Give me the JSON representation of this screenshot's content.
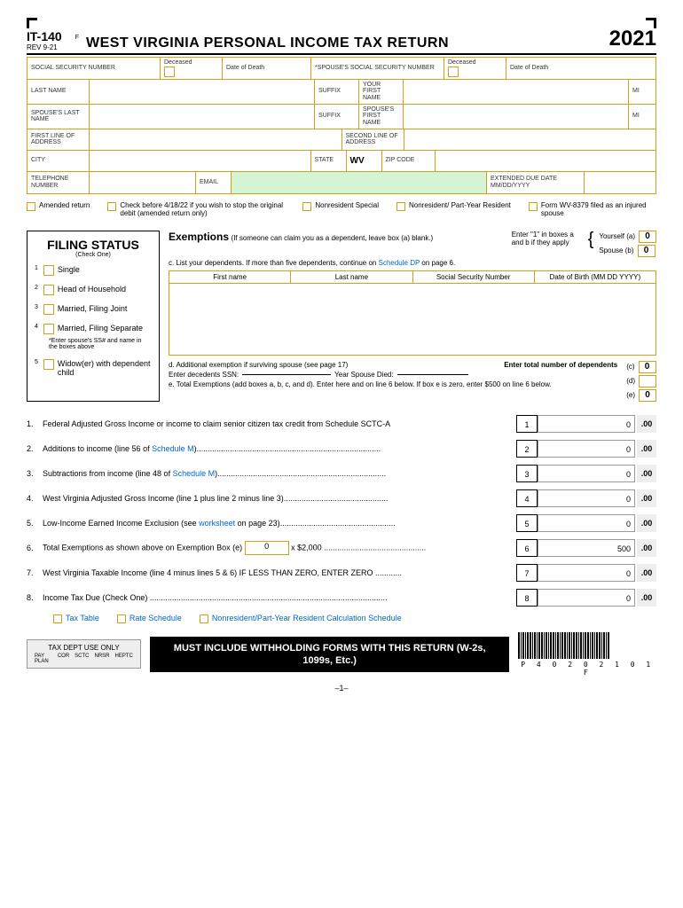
{
  "header": {
    "form_num": "IT-140",
    "rev": "REV 9-21",
    "marker": "F",
    "title": "WEST VIRGINIA PERSONAL INCOME TAX RETURN",
    "year": "2021"
  },
  "info": {
    "ssn": "SOCIAL SECURITY NUMBER",
    "deceased": "Deceased",
    "dod": "Date of Death",
    "spouse_ssn": "*SPOUSE'S SOCIAL SECURITY NUMBER",
    "last_name": "LAST NAME",
    "suffix": "SUFFIX",
    "first_name": "YOUR FIRST NAME",
    "mi": "MI",
    "spouse_last": "SPOUSE'S LAST NAME",
    "spouse_first": "SPOUSE'S FIRST NAME",
    "addr1": "FIRST LINE OF ADDRESS",
    "addr2": "SECOND LINE OF ADDRESS",
    "city": "CITY",
    "state": "STATE",
    "state_val": "WV",
    "zip": "ZIP CODE",
    "phone": "TELEPHONE NUMBER",
    "email": "EMAIL",
    "ext_due": "EXTENDED DUE DATE MM/DD/YYYY"
  },
  "checkboxes": {
    "amended": "Amended return",
    "check_before": "Check before 4/18/22 if you wish to stop the original debit (amended return only)",
    "nonres_special": "Nonresident Special",
    "nonres_part": "Nonresident/ Part-Year Resident",
    "wv8379": "Form WV-8379 filed as an injured spouse"
  },
  "filing": {
    "title": "FILING STATUS",
    "sub": "(Check One)",
    "single": "Single",
    "hoh": "Head of Household",
    "mfj": "Married, Filing Joint",
    "mfs": "Married, Filing Separate",
    "mfs_note": "*Enter spouse's SS# and name in the boxes above",
    "widow": "Widow(er) with dependent child"
  },
  "exemptions": {
    "title": "Exemptions",
    "note": "(If someone can claim you as a dependent, leave box (a) blank.)",
    "enter1": "Enter \"1\" in boxes a and b if they apply",
    "yourself": "Yourself (a)",
    "spouse": "Spouse (b)",
    "a_val": "0",
    "b_val": "0",
    "list_note": "c. List your dependents. If more than five dependents, continue on",
    "sched_dp": "Schedule DP",
    "on_page": "on page 6.",
    "col_fn": "First name",
    "col_ln": "Last name",
    "col_ssn": "Social Security Number",
    "col_dob": "Date of Birth (MM DD YYYY)",
    "d_text": "d. Additional exemption if surviving spouse (see page 17)",
    "d_ssn": "Enter decedents SSN:",
    "d_year": "Year Spouse Died:",
    "enter_total": "Enter total number of dependents",
    "e_text": "e. Total Exemptions (add boxes a, b, c, and d). Enter here and on line 6 below. If box e is zero, enter $500 on line 6 below.",
    "c_val": "0",
    "d_val": "",
    "e_val": "0"
  },
  "lines": [
    {
      "num": "1.",
      "text": "Federal Adjusted Gross Income or income to claim senior citizen tax credit from Schedule SCTC-A",
      "box": "1",
      "amount": "0"
    },
    {
      "num": "2.",
      "text": "Additions to income (line 56 of",
      "link": "Schedule M",
      "after": ")",
      "box": "2",
      "amount": "0"
    },
    {
      "num": "3.",
      "text": "Subtractions from income (line 48 of",
      "link": "Schedule M",
      "after": ")",
      "box": "3",
      "amount": "0"
    },
    {
      "num": "4.",
      "text": "West Virginia Adjusted Gross Income (line 1 plus line 2 minus line 3)",
      "box": "4",
      "amount": "0"
    },
    {
      "num": "5.",
      "text": "Low-Income Earned Income Exclusion (see",
      "link": "worksheet",
      "after": " on page 23)",
      "box": "5",
      "amount": "0"
    },
    {
      "num": "6.",
      "text": "Total Exemptions as shown above on Exemption Box (e)",
      "inline_val": "0",
      "after": " x $2,000 ",
      "box": "6",
      "amount": "500"
    },
    {
      "num": "7.",
      "text": "West Virginia Taxable Income (line 4 minus lines 5 & 6) IF LESS THAN ZERO, ENTER ZERO ",
      "box": "7",
      "amount": "0"
    },
    {
      "num": "8.",
      "text": "Income Tax Due (Check One) ",
      "box": "8",
      "amount": "0"
    }
  ],
  "line8_opts": {
    "tax_table": "Tax Table",
    "rate_sched": "Rate Schedule",
    "nonres_calc": "Nonresident/Part-Year Resident Calculation Schedule"
  },
  "footer": {
    "tax_dept": "TAX DEPT USE ONLY",
    "cols": [
      "PAY PLAN",
      "COR",
      "SCTC",
      "NRSR",
      "HEPTC"
    ],
    "must": "MUST INCLUDE WITHHOLDING FORMS WITH THIS RETURN (W-2s, 1099s, Etc.)",
    "barcode_text": "P 4 0 2 0 2 1 0 1 F",
    "page": "–1–"
  },
  "cents": ".00"
}
